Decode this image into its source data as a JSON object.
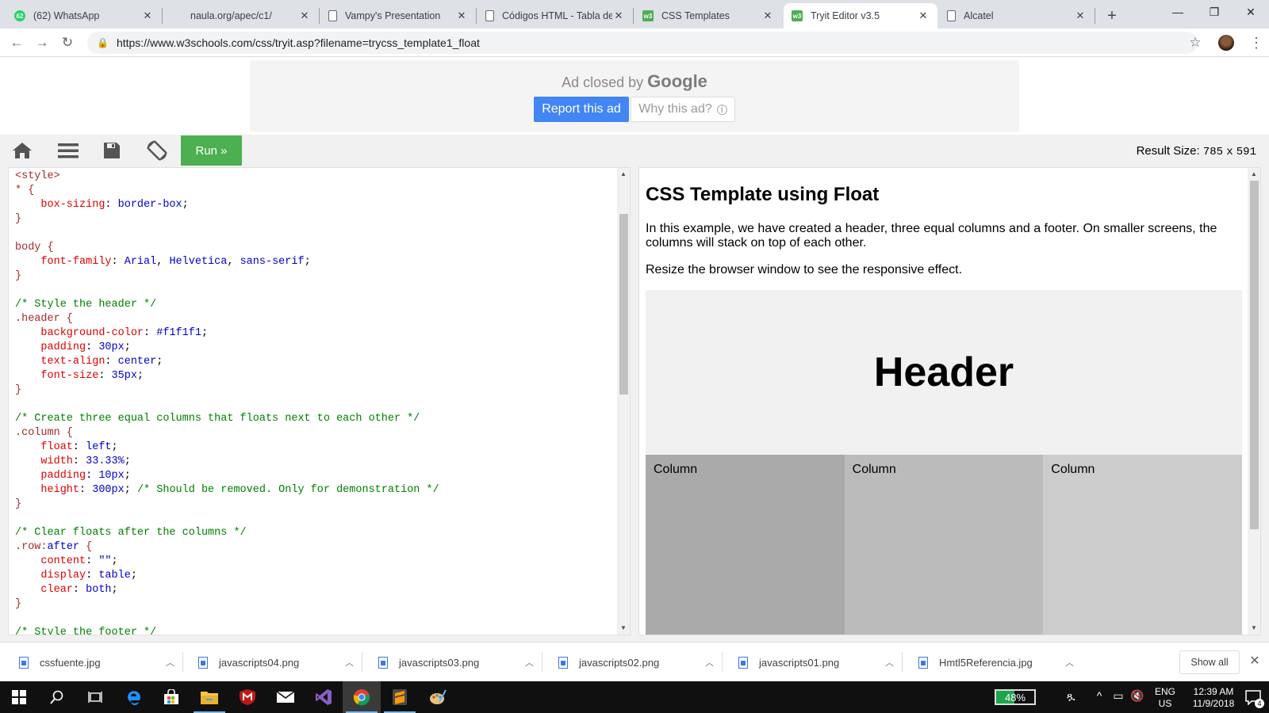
{
  "browser": {
    "tabs": [
      {
        "title": "(62) WhatsApp",
        "badge": "62",
        "active": false
      },
      {
        "title": "naula.org/apec/c1/",
        "active": false
      },
      {
        "title": "Vampy's Presentation",
        "active": false
      },
      {
        "title": "Códigos HTML - Tabla de",
        "active": false
      },
      {
        "title": "CSS Templates",
        "active": false
      },
      {
        "title": "Tryit Editor v3.5",
        "active": true
      },
      {
        "title": "Alcatel",
        "active": false
      }
    ],
    "url": "https://www.w3schools.com/css/tryit.asp?filename=trycss_template1_float"
  },
  "ad": {
    "closed_text": "Ad closed by",
    "brand": "Google",
    "report_label": "Report this ad",
    "why_label": "Why this ad?"
  },
  "tryit": {
    "run_label": "Run »",
    "result_size_label": "Result Size:",
    "result_width": "785",
    "result_x": "x",
    "result_height": "591"
  },
  "result": {
    "heading": "CSS Template using Float",
    "para1": "In this example, we have created a header, three equal columns and a footer. On smaller screens, the columns will stack on top of each other.",
    "para2": "Resize the browser window to see the responsive effect.",
    "header_text": "Header",
    "columns": [
      "Column",
      "Column",
      "Column"
    ],
    "column_colors": [
      "#aaaaaa",
      "#bbbbbb",
      "#cccccc"
    ]
  },
  "downloads": {
    "files": [
      "cssfuente.jpg",
      "javascripts04.png",
      "javascripts03.png",
      "javascripts02.png",
      "javascripts01.png",
      "Hmtl5Referencia.jpg"
    ],
    "show_all": "Show all"
  },
  "taskbar": {
    "battery": "48%",
    "battery_level": 0.48,
    "lang1": "ENG",
    "lang2": "US",
    "time": "12:39 AM",
    "date": "11/9/2018",
    "notifications": "4"
  },
  "colors": {
    "run_green": "#4caf50",
    "report_blue": "#4285f4",
    "code_property": "#e00000",
    "code_value": "#0000cd",
    "code_comment": "#008000",
    "code_selector": "#a52a2a"
  }
}
